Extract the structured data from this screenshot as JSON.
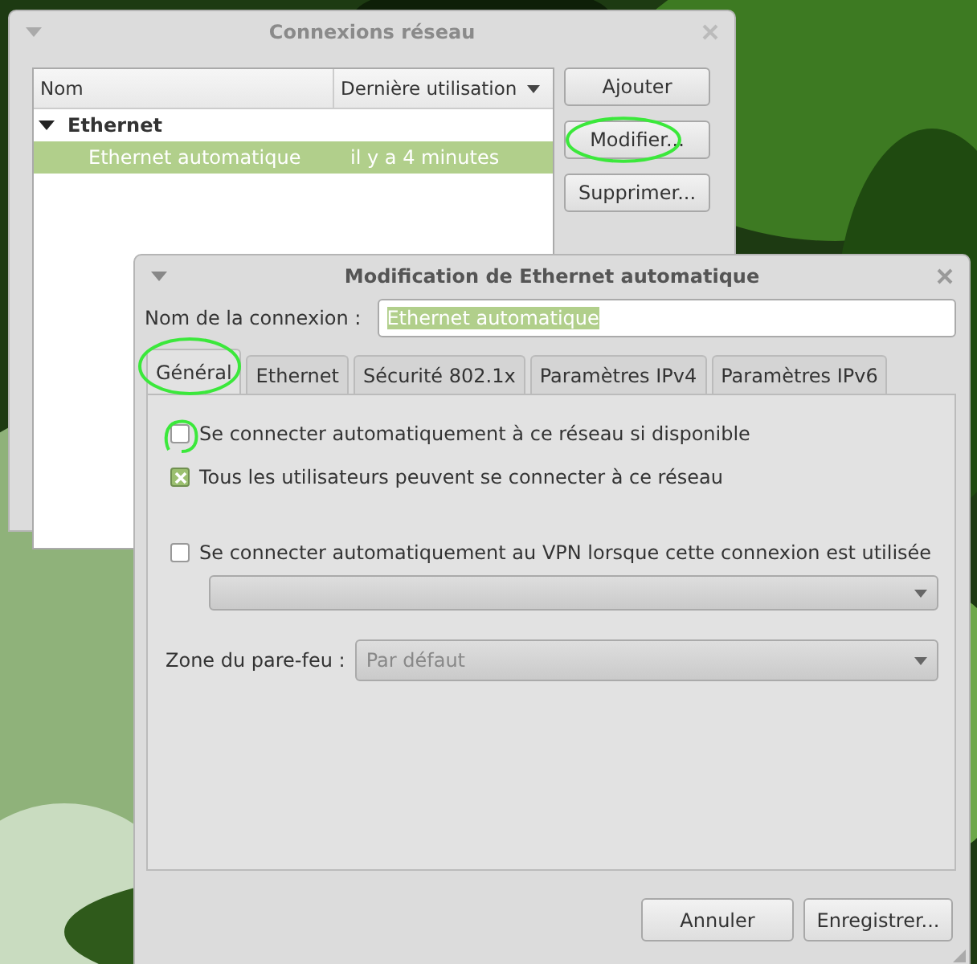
{
  "main_window": {
    "title": "Connexions réseau",
    "columns": [
      "Nom",
      "Dernière utilisation"
    ],
    "groups": [
      {
        "label": "Ethernet",
        "expanded": true,
        "children": [
          {
            "name": "Ethernet automatique",
            "last_used": "il y a 4 minutes",
            "selected": true
          }
        ]
      }
    ],
    "buttons": [
      {
        "label": "Ajouter",
        "annotated": false
      },
      {
        "label": "Modifier...",
        "annotated": true
      },
      {
        "label": "Supprimer...",
        "annotated": false
      }
    ]
  },
  "edit_dialog": {
    "title": "Modification de Ethernet automatique",
    "name_label": "Nom de la connexion :",
    "name_value": "Ethernet automatique",
    "value_selected": true,
    "tabs": [
      {
        "label": "Général",
        "selected": true,
        "annotated": true
      },
      {
        "label": "Ethernet",
        "selected": false,
        "annotated": false
      },
      {
        "label": "Sécurité 802.1x",
        "selected": false,
        "annotated": false
      },
      {
        "label": "Paramètres IPv4",
        "selected": false,
        "annotated": false
      },
      {
        "label": "Paramètres IPv6",
        "selected": false,
        "annotated": false
      }
    ],
    "options": [
      {
        "kind": "checkbox",
        "label": "Se connecter automatiquement à ce réseau si disponible",
        "checked": false,
        "annotated": true
      },
      {
        "kind": "checkbox",
        "label": "Tous les utilisateurs peuvent se connecter à ce réseau",
        "checked": true
      },
      {
        "kind": "checkbox",
        "label": "Se connecter automatiquement au VPN lorsque cette connexion est utilisée",
        "checked": false
      },
      {
        "kind": "dropdown",
        "disabled": true
      },
      {
        "kind": "labeled_dropdown",
        "label": "Zone du pare-feu :",
        "value": "Par défaut",
        "disabled": true
      }
    ],
    "buttons": [
      "Annuler",
      "Enregistrer..."
    ]
  }
}
